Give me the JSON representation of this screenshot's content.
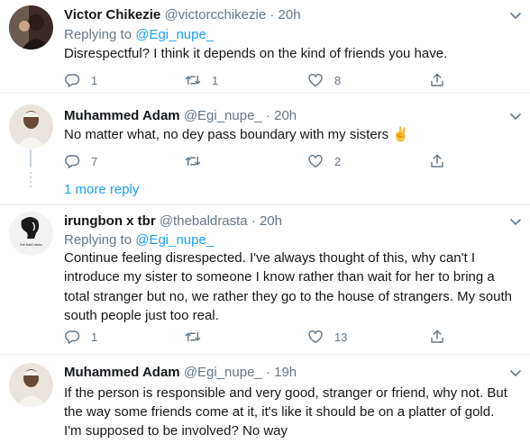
{
  "tweets": [
    {
      "name": "Victor Chikezie",
      "handle": "@victorcchikezie",
      "time": "20h",
      "replying_prefix": "Replying to",
      "replying_to": "@Egi_nupe_",
      "text": "Disrespectful? I think it depends on the kind of friends you have.",
      "reply_count": "1",
      "retweet_count": "1",
      "like_count": "8"
    },
    {
      "name": "Muhammed Adam",
      "handle": "@Egi_nupe_",
      "time": "20h",
      "text": "No matter what, no dey pass boundary with my sisters ✌️",
      "reply_count": "7",
      "retweet_count": "",
      "like_count": "2"
    },
    {
      "name": "irungbon x tbr",
      "handle": "@thebaldrasta",
      "time": "20h",
      "replying_prefix": "Replying to",
      "replying_to": "@Egi_nupe_",
      "text": "Continue feeling disrespected. I've always thought of this, why can't I introduce my sister to someone I know rather than wait for her to bring a total stranger but no, we rather they go to the house of strangers. My south south people just too real.",
      "reply_count": "1",
      "retweet_count": "",
      "like_count": "13",
      "avatar_text": "the bald rasta"
    },
    {
      "name": "Muhammed Adam",
      "handle": "@Egi_nupe_",
      "time": "19h",
      "text": "If the person is responsible and very good, stranger or friend, why not. But the way some friends come at it, it's like it should be on a platter of gold. I'm supposed to be involved? No way"
    }
  ],
  "more_replies": "1 more reply",
  "separator_dot": "·",
  "colors": {
    "accent": "#1da1f2",
    "secondary": "#657786",
    "border": "#e6ecf0",
    "text": "#14171a"
  }
}
